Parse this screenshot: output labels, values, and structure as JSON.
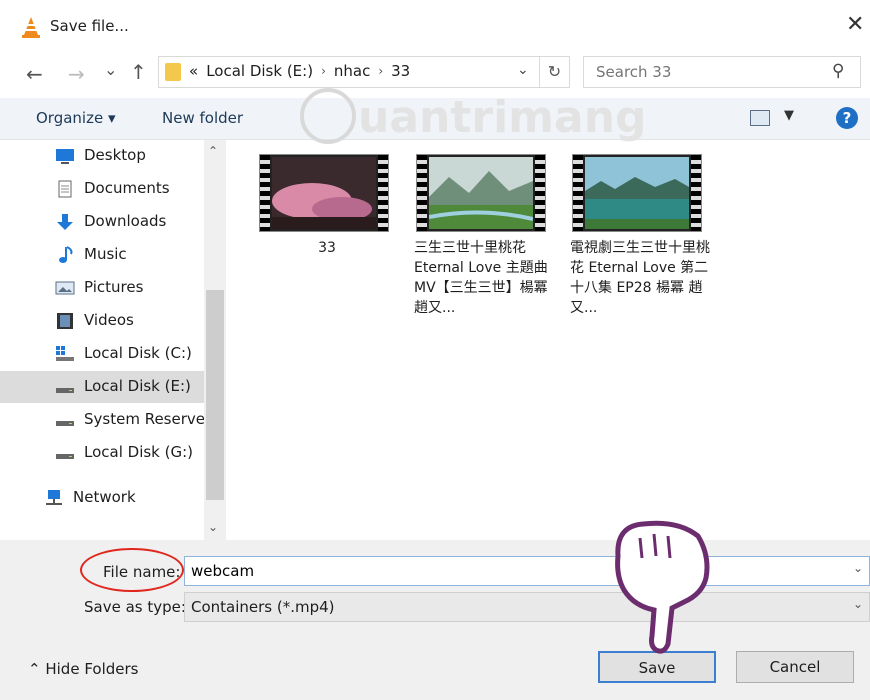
{
  "window": {
    "title": "Save file..."
  },
  "nav": {
    "back": "←",
    "forward": "→",
    "recent": "⌄",
    "up": "↑"
  },
  "address": {
    "prefix": "«",
    "crumbs": [
      "Local Disk (E:)",
      "nhac",
      "33"
    ],
    "separator": "›"
  },
  "search": {
    "placeholder": "Search 33"
  },
  "toolbar": {
    "organize": "Organize ▾",
    "new_folder": "New folder",
    "help": "?"
  },
  "sidebar": {
    "items": [
      {
        "label": "Desktop",
        "icon": "desktop-icon"
      },
      {
        "label": "Documents",
        "icon": "documents-icon"
      },
      {
        "label": "Downloads",
        "icon": "downloads-icon"
      },
      {
        "label": "Music",
        "icon": "music-icon"
      },
      {
        "label": "Pictures",
        "icon": "pictures-icon"
      },
      {
        "label": "Videos",
        "icon": "videos-icon"
      },
      {
        "label": "Local Disk (C:)",
        "icon": "drive-icon"
      },
      {
        "label": "Local Disk (E:)",
        "icon": "drive-icon",
        "selected": true
      },
      {
        "label": "System Reserved",
        "icon": "drive-icon"
      },
      {
        "label": "Local Disk (G:)",
        "icon": "drive-icon"
      },
      {
        "label": "Network",
        "icon": "network-icon"
      }
    ]
  },
  "files": [
    {
      "name": "33"
    },
    {
      "name": "三生三世十里桃花 Eternal Love 主題曲MV【三生三世】楊冪 趙又..."
    },
    {
      "name": "電視劇三生三世十里桃花 Eternal Love 第二十八集 EP28 楊冪 趙又..."
    }
  ],
  "form": {
    "file_name_label": "File name:",
    "file_name_value": "webcam",
    "save_as_type_label": "Save as type:",
    "save_as_type_value": "Containers (*.mp4)"
  },
  "footer": {
    "hide_folders": "Hide Folders",
    "save": "Save",
    "cancel": "Cancel"
  },
  "colors": {
    "accent": "#1f6fc5",
    "annotation": "#e0261d",
    "hand": "#6b2d6e"
  }
}
